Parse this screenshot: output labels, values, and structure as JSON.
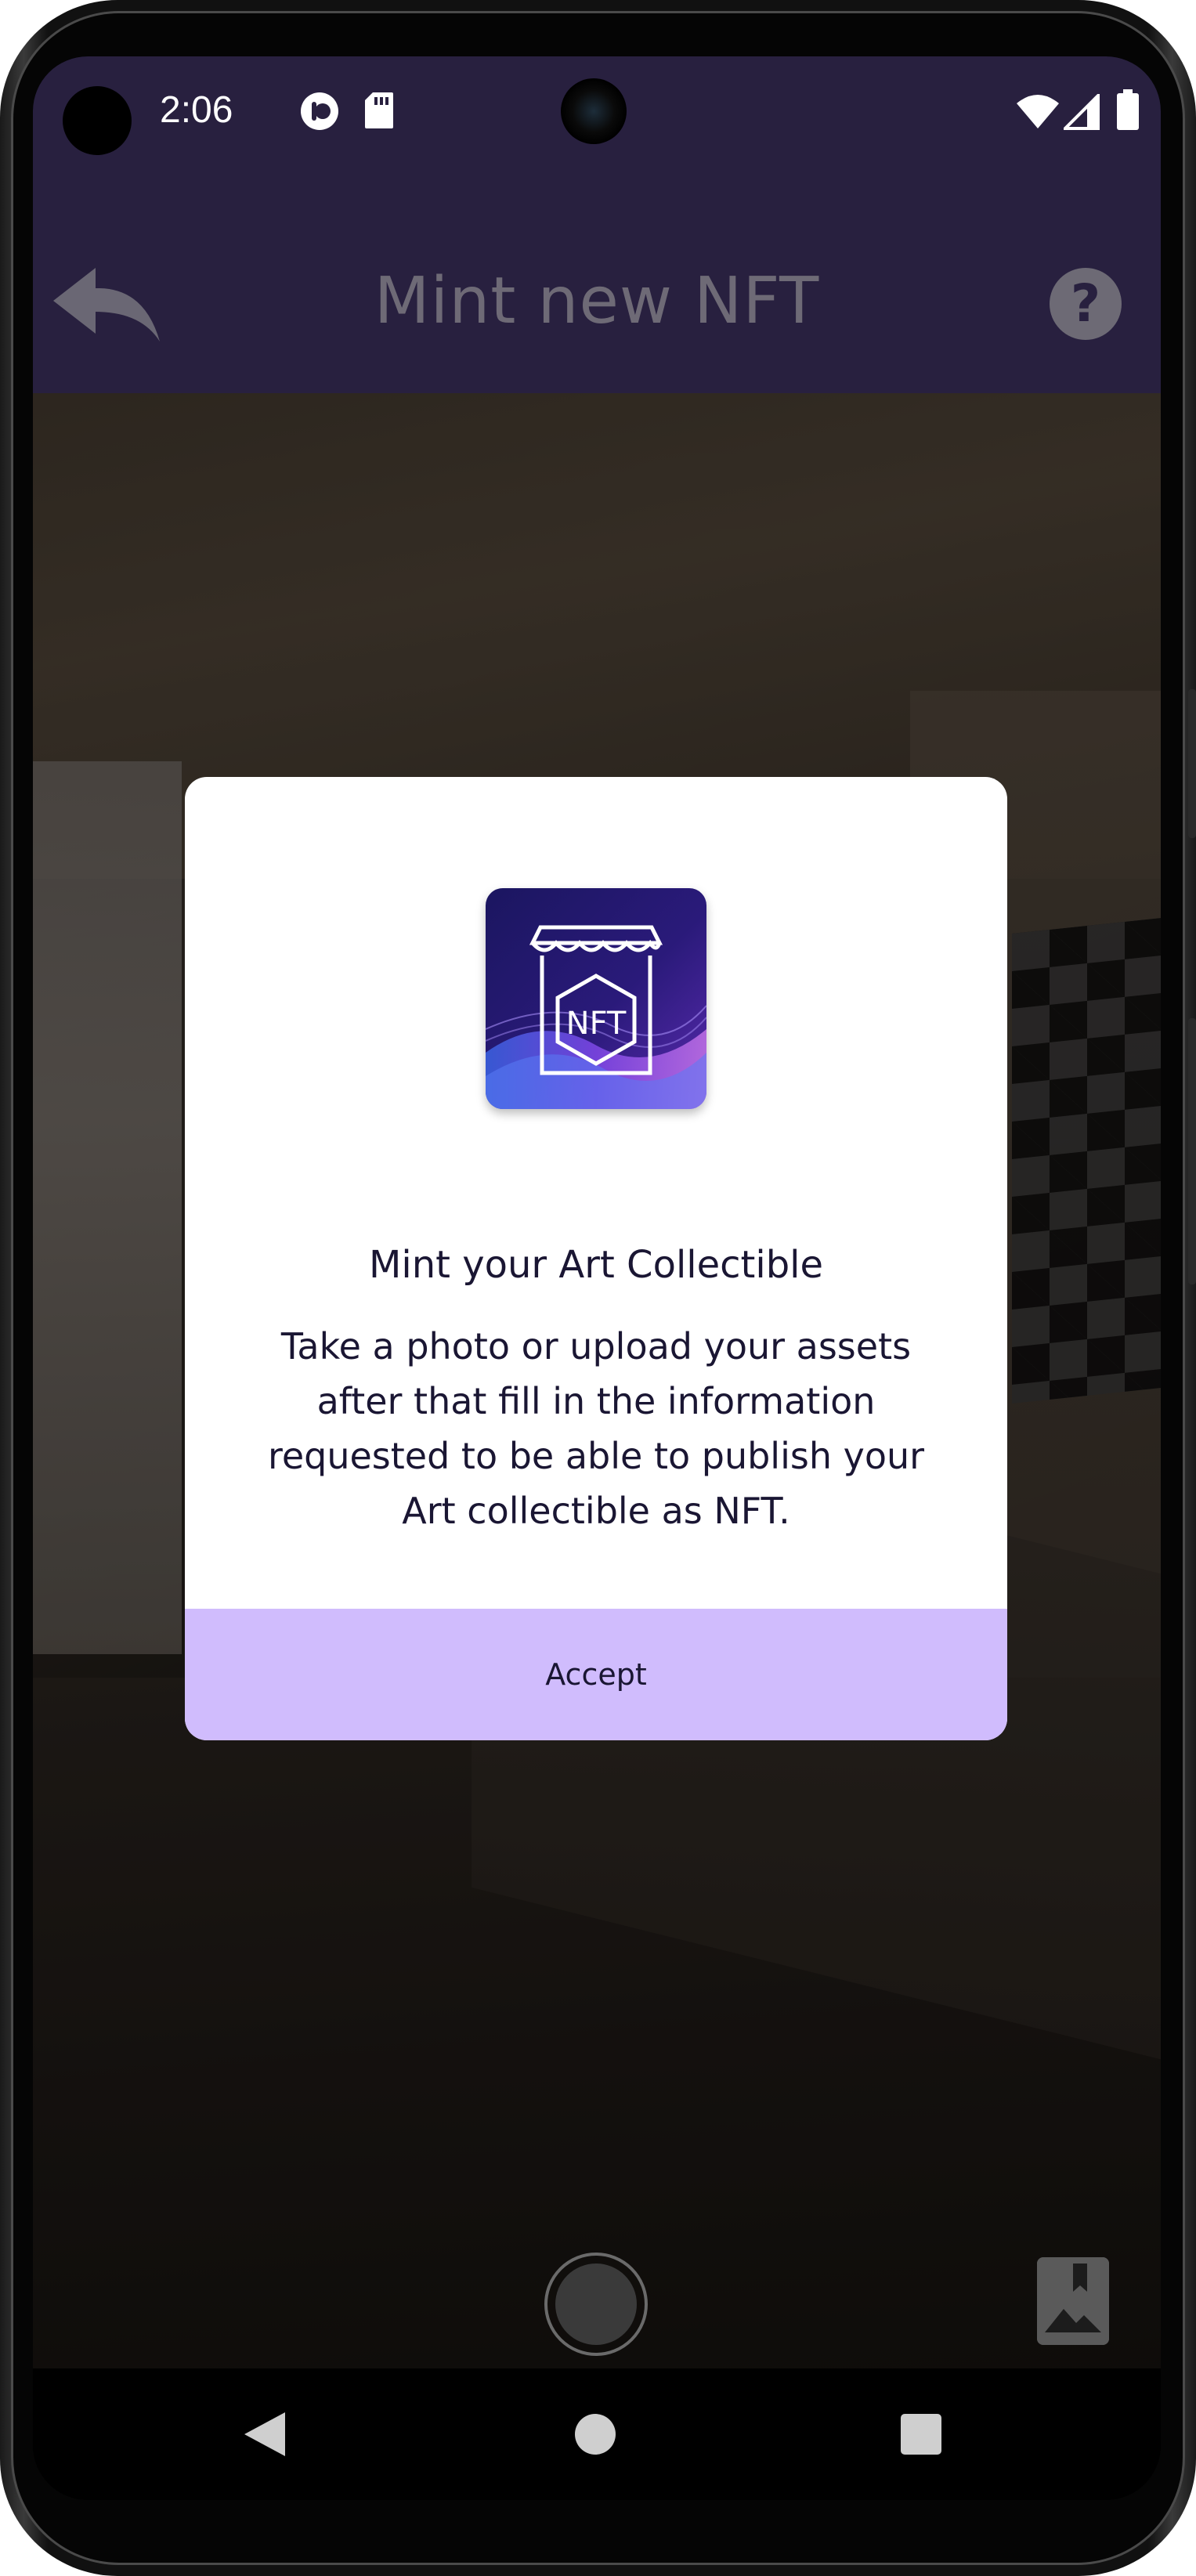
{
  "status_bar": {
    "time": "2:06",
    "icons": [
      "notification-dot-icon",
      "sd-card-icon",
      "wifi-icon",
      "signal-icon",
      "battery-icon"
    ]
  },
  "app_bar": {
    "title": "Mint new NFT",
    "back_icon": "back-arrow-icon",
    "help_icon": "help-icon",
    "help_glyph": "?"
  },
  "dialog": {
    "logo_text": "NFT",
    "title": "Mint your Art Collectible",
    "body": "Take a photo or upload your assets after that fill in the information requested to be able to publish your Art collectible as NFT.",
    "accept_label": "Accept"
  },
  "camera": {
    "shutter_icon": "shutter-icon",
    "gallery_icon": "gallery-icon"
  },
  "nav_bar": {
    "back_icon": "nav-back-icon",
    "home_icon": "nav-home-icon",
    "recents_icon": "nav-recents-icon"
  },
  "colors": {
    "app_bar": "#28203f",
    "accept_button": "#d0bcfd",
    "text_dark": "#1a1633"
  }
}
